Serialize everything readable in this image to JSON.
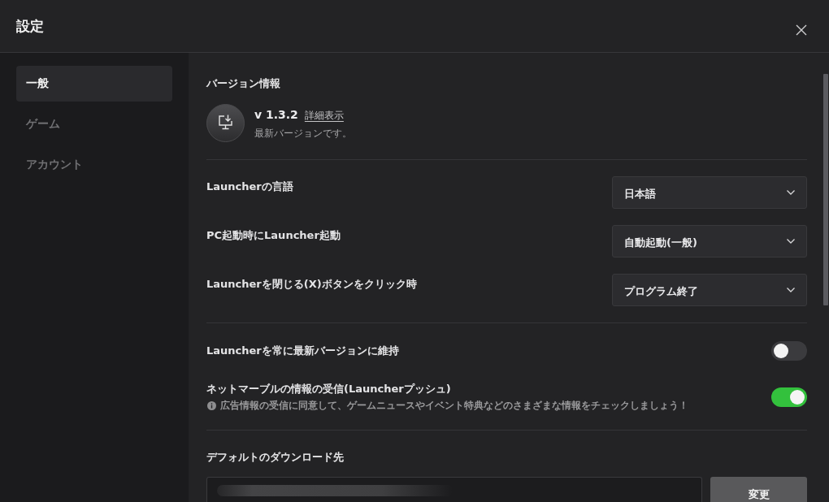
{
  "window": {
    "title": "設定"
  },
  "sidebar": {
    "items": [
      {
        "label": "一般",
        "selected": true
      },
      {
        "label": "ゲーム",
        "selected": false
      },
      {
        "label": "アカウント",
        "selected": false
      }
    ]
  },
  "version_info": {
    "heading": "バージョン情報",
    "version": "v 1.3.2",
    "details_link": "詳細表示",
    "status": "最新バージョンです。"
  },
  "dropdowns": [
    {
      "label": "Launcherの言語",
      "value": "日本語"
    },
    {
      "label": "PC起動時にLauncher起動",
      "value": "自動起動(一般)"
    },
    {
      "label": "Launcherを閉じる(X)ボタンをクリック時",
      "value": "プログラム終了"
    }
  ],
  "toggles": [
    {
      "label": "Launcherを常に最新バージョンに維持",
      "on": false
    },
    {
      "label": "ネットマーブルの情報の受信(Launcherプッシュ)",
      "note": "広告情報の受信に同意して、ゲームニュースやイベント特典などのさまざまな情報をチェックしましょう！",
      "on": true
    }
  ],
  "download_location": {
    "heading": "デフォルトのダウンロード先",
    "value_blurred": true,
    "button": "変更"
  }
}
